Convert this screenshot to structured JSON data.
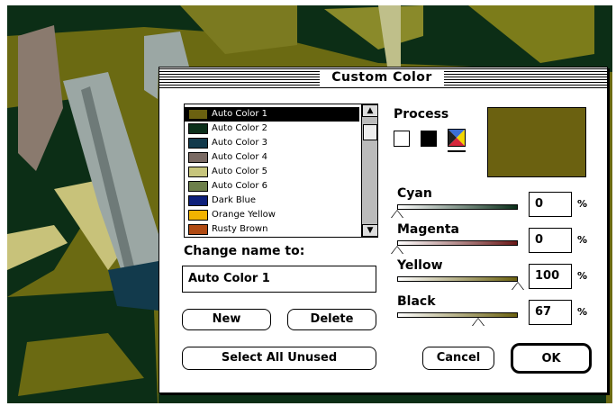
{
  "dialog": {
    "title": "Custom Color"
  },
  "color_list": {
    "items": [
      {
        "label": "Auto Color 1",
        "color": "#6b6110",
        "selected": true
      },
      {
        "label": "Auto Color 2",
        "color": "#0b2f1a"
      },
      {
        "label": "Auto Color 3",
        "color": "#123a4c"
      },
      {
        "label": "Auto Color 4",
        "color": "#7a6a63"
      },
      {
        "label": "Auto Color 5",
        "color": "#c7c57c"
      },
      {
        "label": "Auto Color 6",
        "color": "#6d7f4a"
      },
      {
        "label": "Dark Blue",
        "color": "#0d1f7a"
      },
      {
        "label": "Orange Yellow",
        "color": "#f2b300"
      },
      {
        "label": "Rusty Brown",
        "color": "#b04a12"
      }
    ]
  },
  "rename": {
    "label": "Change name to:",
    "value": "Auto Color 1"
  },
  "buttons": {
    "new": "New",
    "delete": "Delete",
    "select_all_unused": "Select All Unused",
    "cancel": "Cancel",
    "ok": "OK"
  },
  "process": {
    "label": "Process",
    "preview_color": "#6b6110"
  },
  "inks": [
    {
      "name": "Cyan",
      "value": "0",
      "unit": "%",
      "level": 0,
      "bar_color": "#0b2f1a"
    },
    {
      "name": "Magenta",
      "value": "0",
      "unit": "%",
      "level": 0,
      "bar_color": "#6a1818"
    },
    {
      "name": "Yellow",
      "value": "100",
      "unit": "%",
      "level": 1.0,
      "bar_color": "#6b6110"
    },
    {
      "name": "Black",
      "value": "67",
      "unit": "%",
      "level": 0.67,
      "bar_color": "#6b6110"
    }
  ],
  "scroll": {
    "up_arrow": "up-arrow-icon",
    "down_arrow": "down-arrow-icon"
  }
}
